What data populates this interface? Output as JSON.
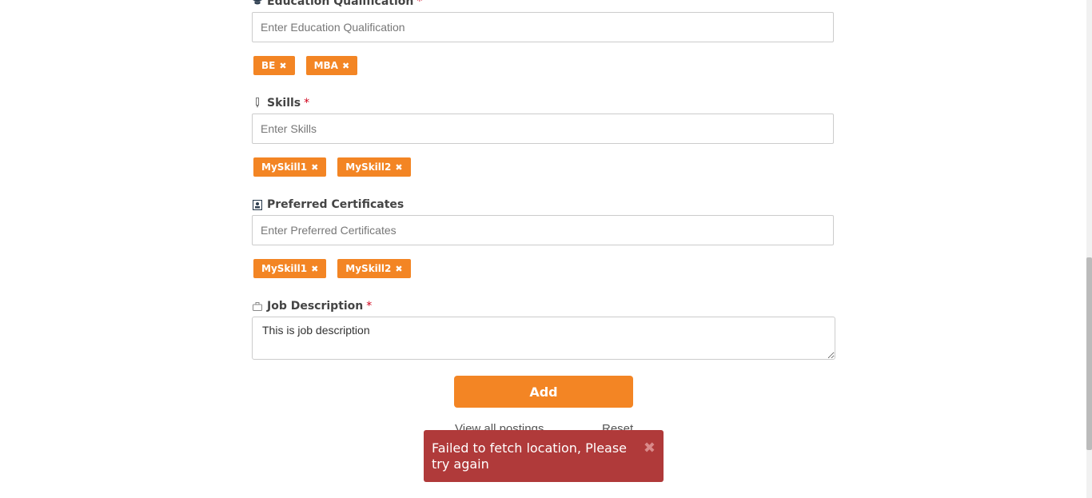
{
  "education": {
    "label": "Education Qualification",
    "required": "*",
    "placeholder": "Enter Education Qualification",
    "tags": [
      "BE",
      "MBA"
    ]
  },
  "skills": {
    "label": "Skills",
    "required": "*",
    "placeholder": "Enter Skills",
    "tags": [
      "MySkill1",
      "MySkill2"
    ]
  },
  "certificates": {
    "label": "Preferred Certificates",
    "placeholder": "Enter Preferred Certificates",
    "tags": [
      "MySkill1",
      "MySkill2"
    ]
  },
  "job_description": {
    "label": "Job Description",
    "required": "*",
    "value": "This is job description"
  },
  "actions": {
    "add_label": "Add",
    "view_all_label": "View all postings",
    "reset_label": "Reset"
  },
  "toast": {
    "message": "Failed to fetch location, Please try again",
    "close": "✖"
  },
  "tag_remove_glyph": "✖",
  "colors": {
    "accent": "#f38524",
    "error": "#b03a3a",
    "required": "#d0021b"
  },
  "icons": {
    "education": "graduation-cap-icon",
    "skills": "pencil-icon",
    "certificates": "certificate-icon",
    "job_description": "briefcase-icon"
  }
}
